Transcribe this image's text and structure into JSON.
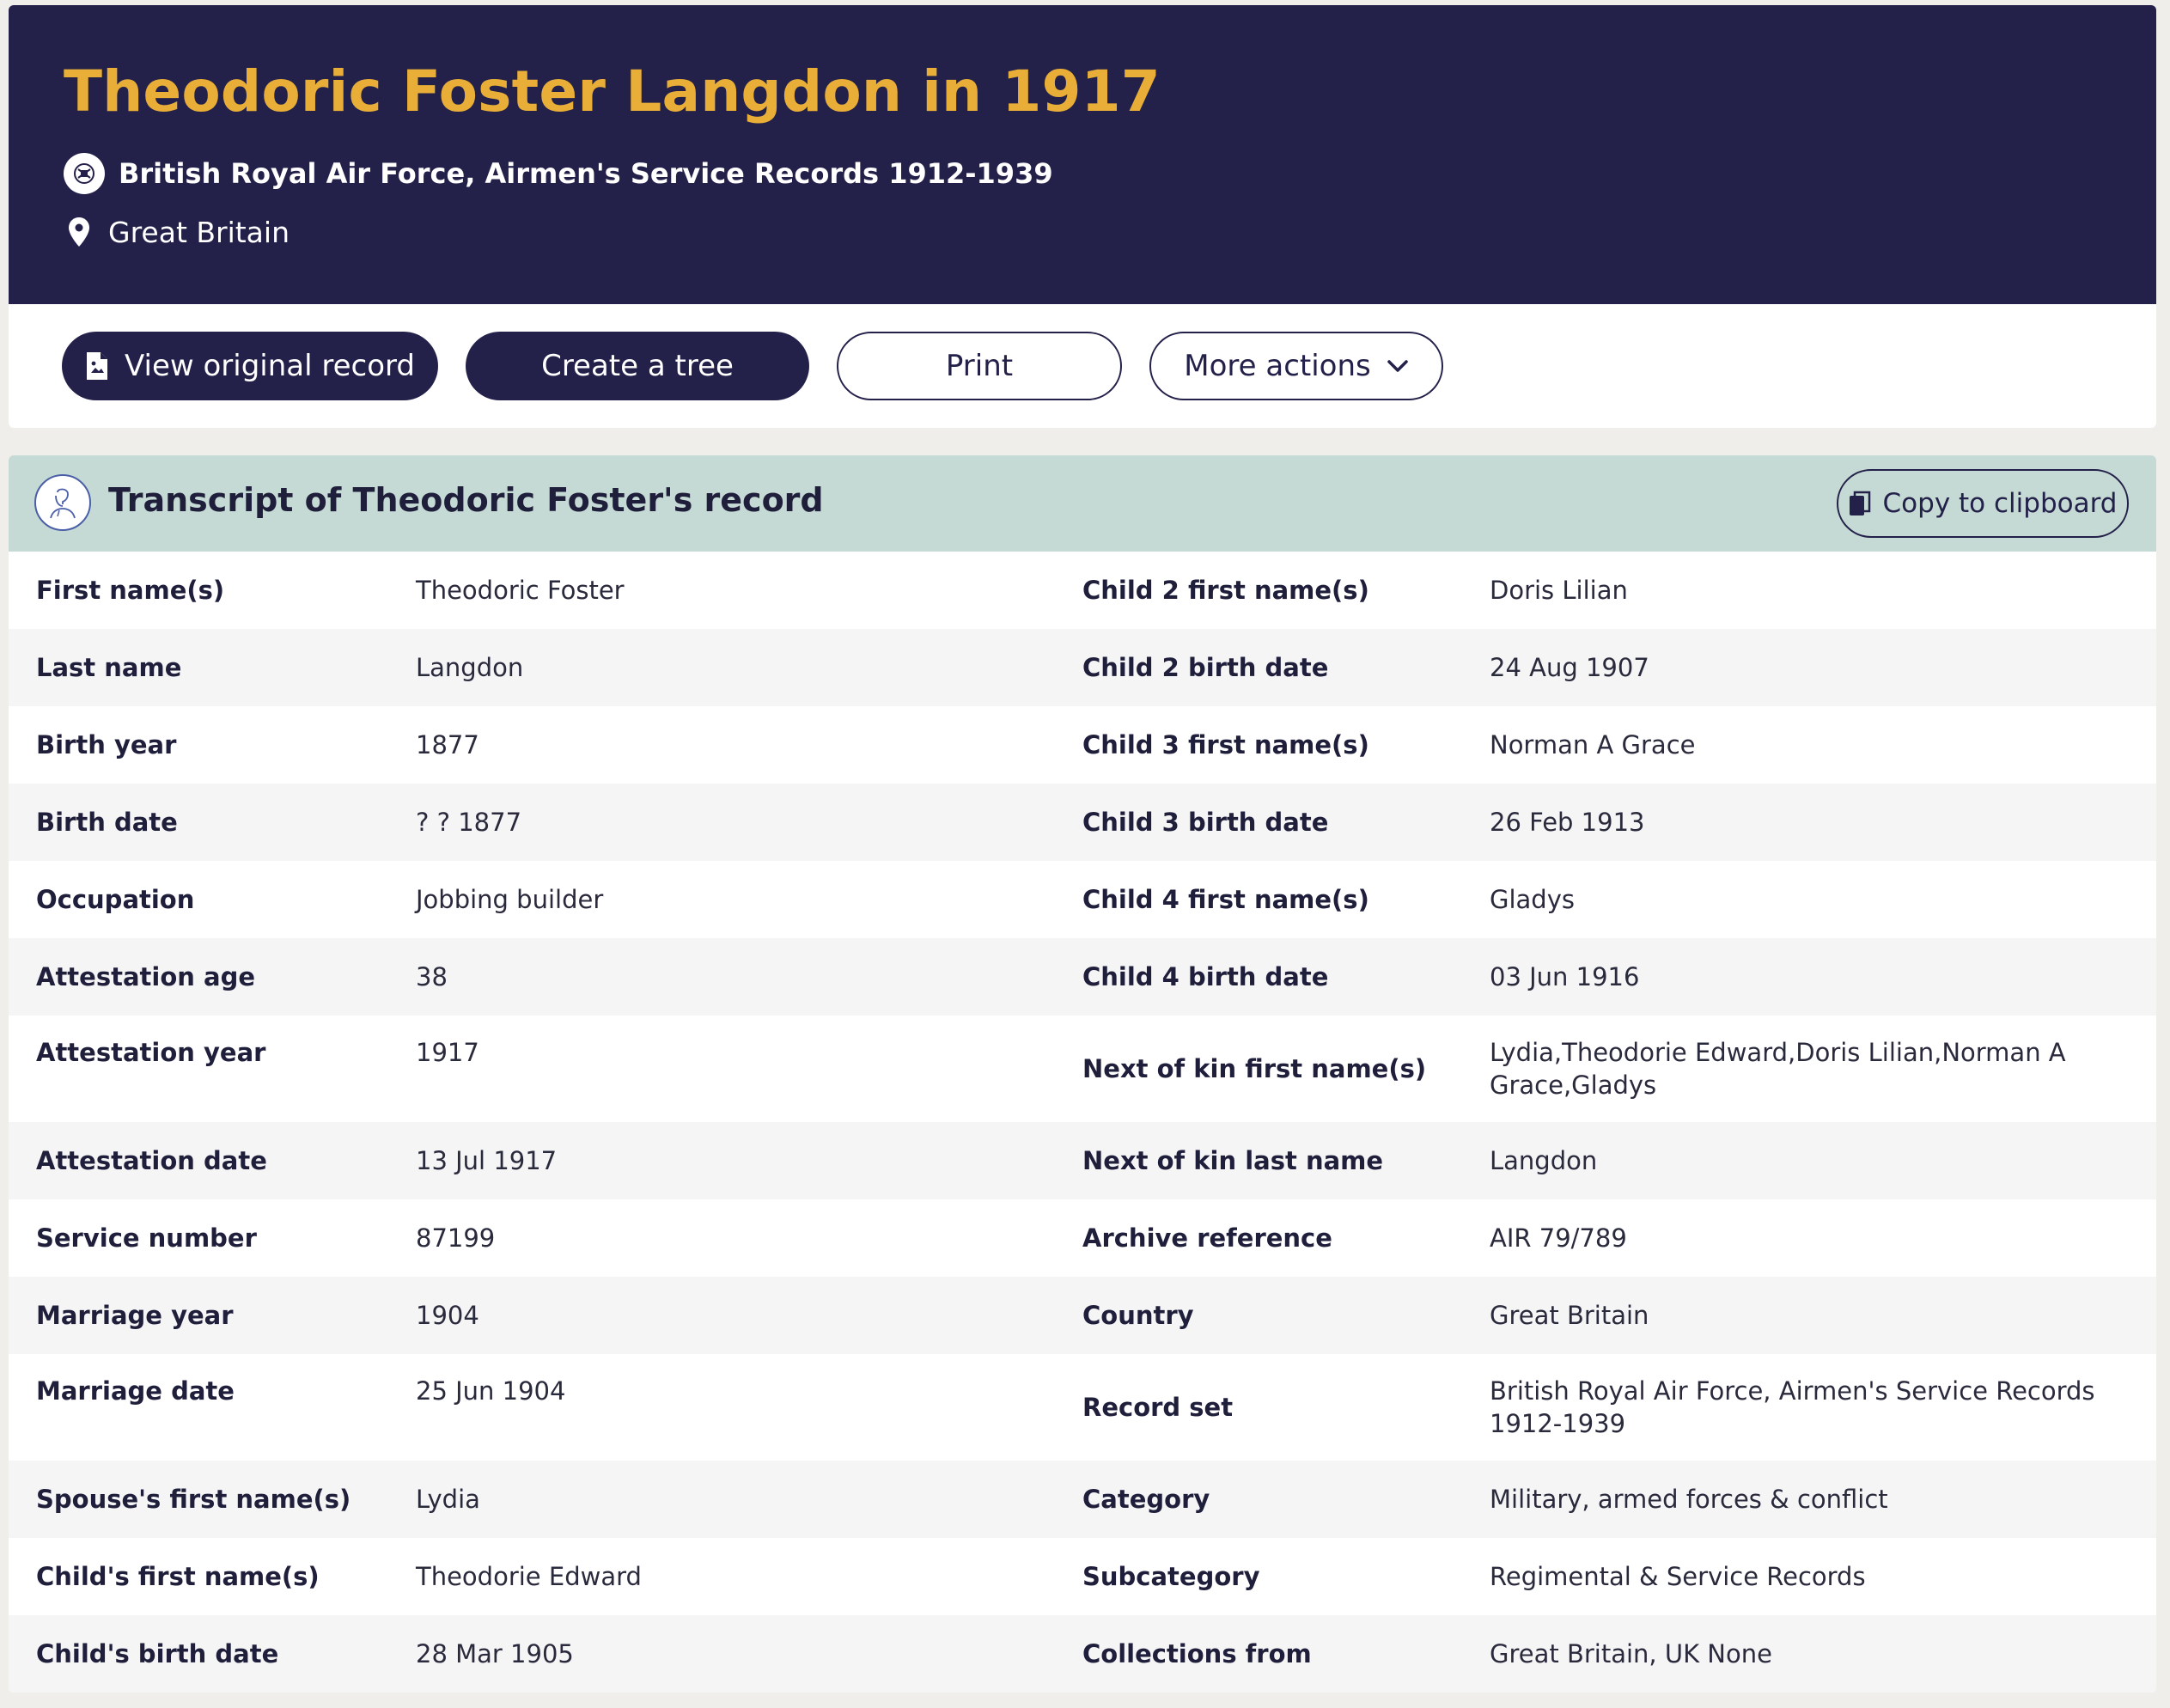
{
  "header": {
    "title": "Theodoric Foster Langdon in 1917",
    "record_set": "British Royal Air Force, Airmen's Service Records 1912-1939",
    "location": "Great Britain",
    "background": "#232149",
    "title_color": "#e8ae37"
  },
  "actions": {
    "view_original": "View original record",
    "create_tree": "Create a tree",
    "print": "Print",
    "more_actions": "More actions"
  },
  "transcript": {
    "title": "Transcript of Theodoric Foster's record",
    "copy_label": "Copy to clipboard",
    "header_color": "#c5dad4",
    "rows": [
      {
        "l1": "First name(s)",
        "v1": "Theodoric Foster",
        "l2": "Child 2 first name(s)",
        "v2": "Doris Lilian"
      },
      {
        "l1": "Last name",
        "v1": "Langdon",
        "l2": "Child 2 birth date",
        "v2": "24 Aug 1907"
      },
      {
        "l1": "Birth year",
        "v1": "1877",
        "l2": "Child 3 first name(s)",
        "v2": "Norman A Grace"
      },
      {
        "l1": "Birth date",
        "v1": "? ? 1877",
        "l2": "Child 3 birth date",
        "v2": "26 Feb 1913"
      },
      {
        "l1": "Occupation",
        "v1": "Jobbing builder",
        "l2": "Child 4 first name(s)",
        "v2": "Gladys"
      },
      {
        "l1": "Attestation age",
        "v1": "38",
        "l2": "Child 4 birth date",
        "v2": "03 Jun 1916"
      },
      {
        "l1": "Attestation year",
        "v1": "1917",
        "l2": "Next of kin first name(s)",
        "v2": "Lydia,Theodorie Edward,Doris Lilian,Norman A Grace,Gladys"
      },
      {
        "l1": "Attestation date",
        "v1": "13 Jul 1917",
        "l2": "Next of kin last name",
        "v2": "Langdon"
      },
      {
        "l1": "Service number",
        "v1": "87199",
        "l2": "Archive reference",
        "v2": "AIR 79/789"
      },
      {
        "l1": "Marriage year",
        "v1": "1904",
        "l2": "Country",
        "v2": "Great Britain"
      },
      {
        "l1": "Marriage date",
        "v1": "25 Jun 1904",
        "l2": "Record set",
        "v2": "British Royal Air Force, Airmen's Service Records 1912-1939"
      },
      {
        "l1": "Spouse's first name(s)",
        "v1": "Lydia",
        "l2": "Category",
        "v2": "Military, armed forces & conflict"
      },
      {
        "l1": "Child's first name(s)",
        "v1": "Theodorie Edward",
        "l2": "Subcategory",
        "v2": "Regimental & Service Records"
      },
      {
        "l1": "Child's birth date",
        "v1": "28 Mar 1905",
        "l2": "Collections from",
        "v2": "Great Britain, UK None"
      }
    ]
  },
  "icons": {
    "record_set": "raf-badge-icon",
    "location": "map-pin-icon",
    "view_original": "document-image-icon",
    "more_actions": "chevron-down-icon",
    "copy": "copy-icon",
    "transcript": "person-portrait-icon"
  }
}
